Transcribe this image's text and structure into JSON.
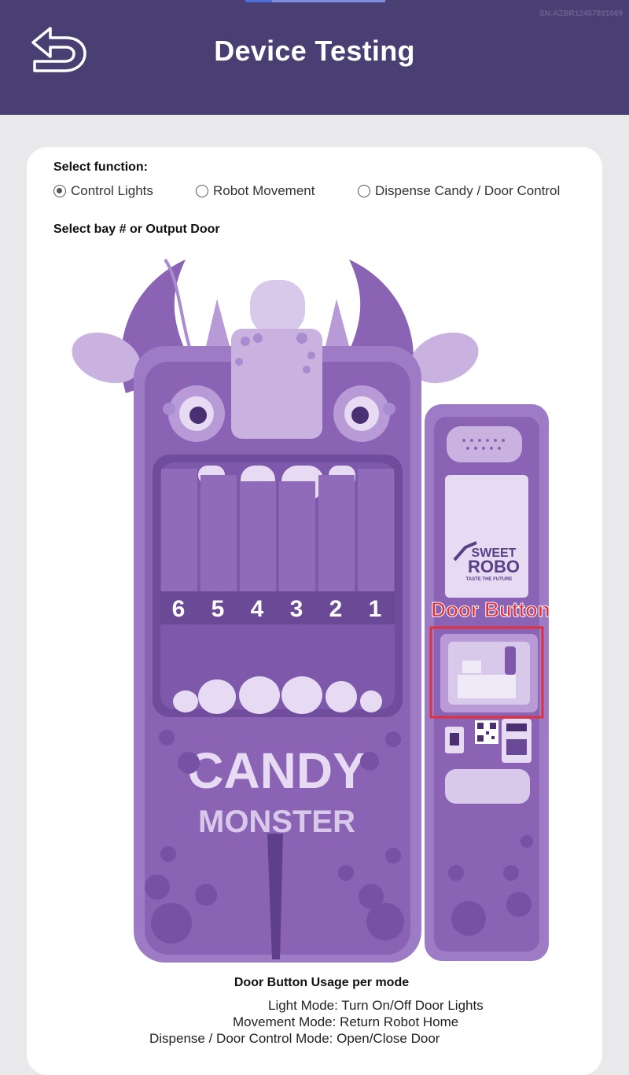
{
  "header": {
    "title": "Device Testing",
    "serial": "SN:AZBR12457891069",
    "back_icon": "back-arrow-icon"
  },
  "function_select": {
    "label": "Select function:",
    "options": [
      {
        "label": "Control Lights",
        "selected": true
      },
      {
        "label": "Robot Movement",
        "selected": false
      },
      {
        "label": "Dispense Candy / Door Control",
        "selected": false
      }
    ]
  },
  "bay_select": {
    "label": "Select bay # or Output Door",
    "bays": [
      "6",
      "5",
      "4",
      "3",
      "2",
      "1"
    ],
    "door_button_label": "Door Button"
  },
  "machine": {
    "name_line1": "CANDY",
    "name_line2": "MONSTER",
    "brand_line1": "SWEET",
    "brand_line2": "ROBO",
    "brand_tagline": "TASTE THE FUTURE"
  },
  "usage": {
    "title": "Door Button Usage per mode",
    "lines": [
      "Light Mode: Turn On/Off Door Lights",
      "Movement Mode: Return Robot Home",
      "Dispense / Door Control Mode: Open/Close Door"
    ]
  },
  "colors": {
    "header_bg": "#4a3f73",
    "machine_purple": "#8a63b4",
    "highlight_red": "#e0303c"
  }
}
